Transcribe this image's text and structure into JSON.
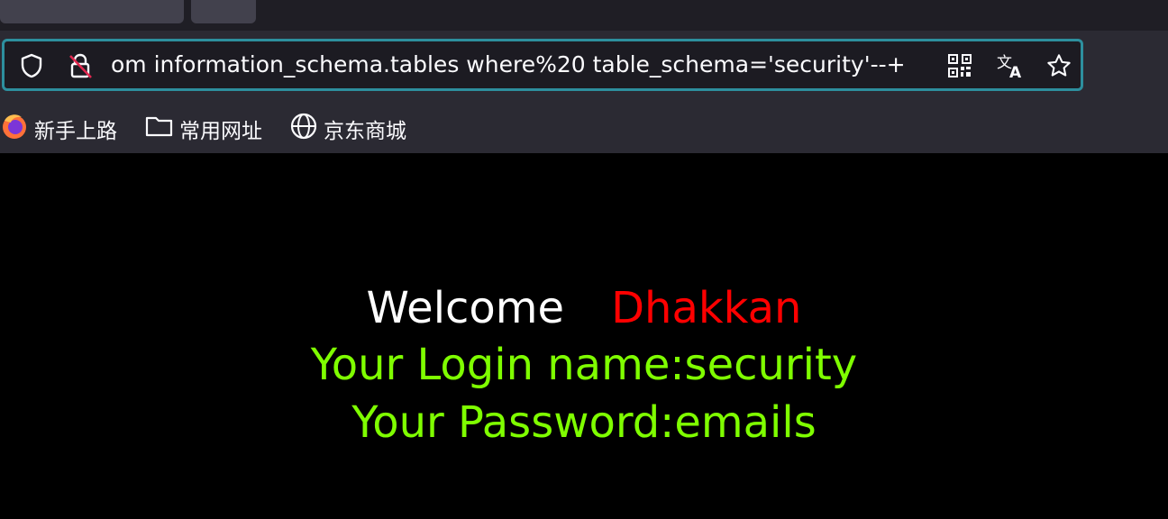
{
  "browser": {
    "url": "...om information_schema.tables where%20 table_schema='security'--+",
    "url_visible": "om information_schema.tables where%20 table_schema='security'--+",
    "bookmarks": [
      {
        "label": "新手上路",
        "icon": "firefox-icon"
      },
      {
        "label": "常用网址",
        "icon": "folder-icon"
      },
      {
        "label": "京东商城",
        "icon": "globe-icon"
      }
    ],
    "accent_color": "#2d8f9e"
  },
  "page": {
    "welcome_label": "Welcome",
    "username": "Dhakkan",
    "login_line": "Your Login name:security",
    "password_line": "Your Password:emails",
    "colors": {
      "welcome": "#ffffff",
      "username": "#ff0000",
      "info": "#7fff00"
    }
  }
}
